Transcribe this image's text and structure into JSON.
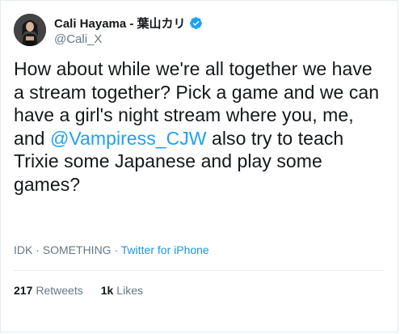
{
  "author": {
    "display_name": "Cali Hayama - 葉山カリ",
    "handle": "@Cali_X",
    "verified": true,
    "avatar_icon": "user-avatar"
  },
  "tweet": {
    "text_before": "How about while we're all together we have a stream together? Pick a game and we can have a girl's night stream where you, me, and ",
    "mention": "@Vampiress_CJW",
    "text_after": " also try to teach Trixie some Japanese and play some games?"
  },
  "meta": {
    "time": "IDK",
    "separator1": " · ",
    "date": "SOMETHING",
    "separator2": " · ",
    "source": "Twitter for iPhone"
  },
  "stats": {
    "retweets_count": "217",
    "retweets_label": "Retweets",
    "likes_count": "1k",
    "likes_label": "Likes"
  },
  "colors": {
    "link": "#1da1f2",
    "text": "#14171a",
    "muted": "#657786",
    "border": "#e6ecf0"
  }
}
